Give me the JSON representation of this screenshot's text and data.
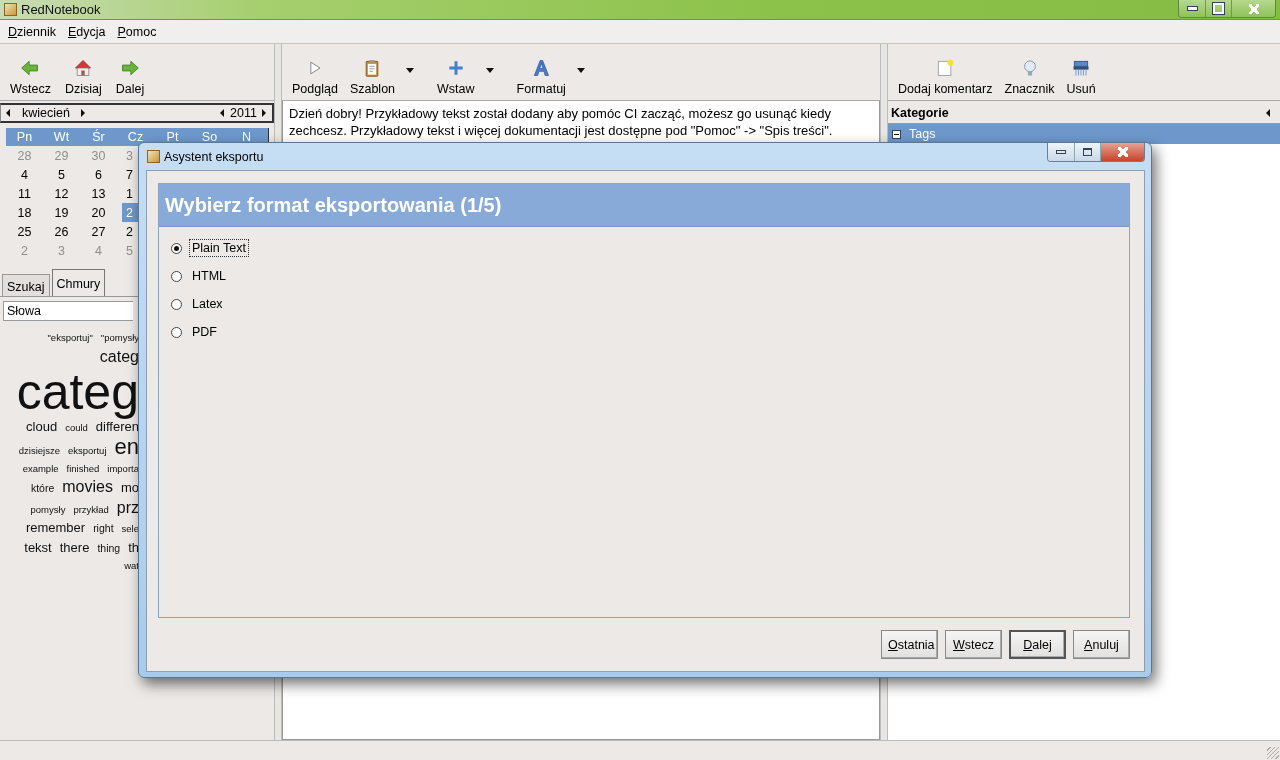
{
  "window": {
    "title": "RedNotebook"
  },
  "menu": [
    {
      "label": "Dziennik"
    },
    {
      "label": "Edycja"
    },
    {
      "label": "Pomoc"
    }
  ],
  "nav_toolbar": [
    {
      "label": "Wstecz",
      "kind": "back",
      "dropdown": false
    },
    {
      "label": "Dzisiaj",
      "kind": "home",
      "dropdown": false
    },
    {
      "label": "Dalej",
      "kind": "forward",
      "dropdown": false
    }
  ],
  "edit_toolbar": [
    {
      "label": "Podgląd",
      "kind": "preview",
      "dropdown": false
    },
    {
      "label": "Szablon",
      "kind": "template",
      "dropdown": true
    },
    {
      "label": "Wstaw",
      "kind": "insert",
      "dropdown": true
    },
    {
      "label": "Formatuj",
      "kind": "format",
      "dropdown": true
    }
  ],
  "annotation_toolbar": [
    {
      "label": "Dodaj komentarz",
      "kind": "note",
      "dropdown": false
    },
    {
      "label": "Znacznik",
      "kind": "bulb",
      "dropdown": false
    },
    {
      "label": "Usuń",
      "kind": "shredder",
      "dropdown": false
    }
  ],
  "calendar": {
    "month": "kwiecień",
    "year": "2011",
    "weekdays": [
      "Pn",
      "Wt",
      "Śr",
      "Cz",
      "Pt",
      "So",
      "N"
    ],
    "weeks": [
      [
        {
          "day": "28",
          "muted": true,
          "selected": false
        },
        {
          "day": "29",
          "muted": true,
          "selected": false
        },
        {
          "day": "30",
          "muted": true,
          "selected": false
        },
        {
          "day": "3",
          "muted": true,
          "selected": false
        }
      ],
      [
        {
          "day": "4",
          "muted": false,
          "selected": false
        },
        {
          "day": "5",
          "muted": false,
          "selected": false
        },
        {
          "day": "6",
          "muted": false,
          "selected": false
        },
        {
          "day": "7",
          "muted": false,
          "selected": false
        }
      ],
      [
        {
          "day": "11",
          "muted": false,
          "selected": false
        },
        {
          "day": "12",
          "muted": false,
          "selected": false
        },
        {
          "day": "13",
          "muted": false,
          "selected": false
        },
        {
          "day": "1",
          "muted": false,
          "selected": false
        }
      ],
      [
        {
          "day": "18",
          "muted": false,
          "selected": false
        },
        {
          "day": "19",
          "muted": false,
          "selected": false
        },
        {
          "day": "20",
          "muted": false,
          "selected": false
        },
        {
          "day": "2",
          "muted": false,
          "selected": true
        }
      ],
      [
        {
          "day": "25",
          "muted": false,
          "selected": false
        },
        {
          "day": "26",
          "muted": false,
          "selected": false
        },
        {
          "day": "27",
          "muted": false,
          "selected": false
        },
        {
          "day": "2",
          "muted": false,
          "selected": false
        }
      ],
      [
        {
          "day": "2",
          "muted": true,
          "selected": false
        },
        {
          "day": "3",
          "muted": true,
          "selected": false
        },
        {
          "day": "4",
          "muted": true,
          "selected": false
        },
        {
          "day": "5",
          "muted": true,
          "selected": false
        }
      ]
    ]
  },
  "sidebar_tabs": [
    {
      "label": "Szukaj",
      "selected": false
    },
    {
      "label": "Chmury",
      "selected": true
    }
  ],
  "cloud_filter": {
    "value": "Słowa"
  },
  "cloud": [
    [
      {
        "text": "\"eksportuj\"",
        "kind": "tiny"
      },
      {
        "text": "\"pomysły",
        "kind": "tiny"
      }
    ],
    [
      {
        "text": "categ",
        "kind": "medium"
      }
    ],
    [
      {
        "text": "categ",
        "kind": "huge"
      }
    ],
    [
      {
        "text": "cloud",
        "kind": "normal"
      },
      {
        "text": "could",
        "kind": "tiny"
      },
      {
        "text": "differen",
        "kind": "normal"
      }
    ],
    [
      {
        "text": "dzisiejsze",
        "kind": "tiny"
      },
      {
        "text": "eksportuj",
        "kind": "tiny"
      },
      {
        "text": "en",
        "kind": "large"
      }
    ],
    [
      {
        "text": "example",
        "kind": "tiny"
      },
      {
        "text": "finished",
        "kind": "tiny"
      },
      {
        "text": "importa",
        "kind": "tiny"
      }
    ],
    [
      {
        "text": "które",
        "kind": "small"
      },
      {
        "text": "movies",
        "kind": "medium"
      },
      {
        "text": "mo",
        "kind": "normal"
      }
    ],
    [
      {
        "text": "pomysły",
        "kind": "tiny"
      },
      {
        "text": "przykład",
        "kind": "tiny"
      },
      {
        "text": "prz",
        "kind": "medium"
      }
    ],
    [
      {
        "text": "remember",
        "kind": "normal"
      },
      {
        "text": "right",
        "kind": "small"
      },
      {
        "text": "sele",
        "kind": "tiny"
      }
    ],
    [
      {
        "text": "tekst",
        "kind": "normal"
      },
      {
        "text": "there",
        "kind": "normal"
      },
      {
        "text": "thing",
        "kind": "small"
      },
      {
        "text": "th",
        "kind": "normal"
      }
    ],
    [
      {
        "text": "wat",
        "kind": "tiny"
      }
    ]
  ],
  "editor": {
    "text": "Dzień dobry! Przykładowy tekst został dodany aby pomóc CI zacząć, możesz go usunąć kiedy zechcesz. Przykładowy tekst i więcej dokumentacji jest dostępne pod \"Pomoc\" -> \"Spis treści\"."
  },
  "categories": {
    "title": "Kategorie",
    "items": [
      {
        "label": "Tags",
        "expanded": true,
        "selected": true
      }
    ]
  },
  "dialog": {
    "title": "Asystent eksportu",
    "heading": "Wybierz format eksportowania (1/5)",
    "options": [
      {
        "label": "Plain Text",
        "selected": true
      },
      {
        "label": "HTML",
        "selected": false
      },
      {
        "label": "Latex",
        "selected": false
      },
      {
        "label": "PDF",
        "selected": false
      }
    ],
    "buttons": [
      {
        "label": "Ostatnia",
        "default": false
      },
      {
        "label": "Wstecz",
        "default": false
      },
      {
        "label": "Dalej",
        "default": true
      },
      {
        "label": "Anuluj",
        "default": false
      }
    ]
  }
}
